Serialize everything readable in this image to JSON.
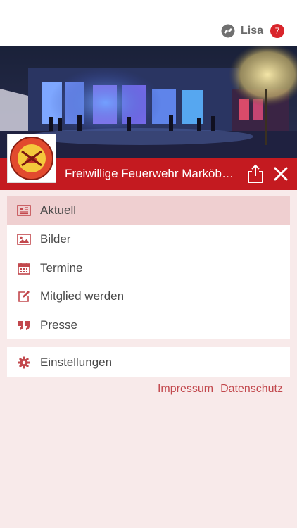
{
  "header": {
    "user_name": "Lisa",
    "notification_count": "7",
    "user_logo_icon": "lisa-logo-icon"
  },
  "banner": {
    "alt": "Feuerwehr building at night",
    "crest_text_top": "FEUERWEHR",
    "crest_text_bottom": "MARKÖBEL e.V."
  },
  "titlebar": {
    "title": "Freiwillige Feuerwehr Marköbel e.V.",
    "share_icon": "share-icon",
    "close_icon": "close-icon",
    "background_color": "#c41a20"
  },
  "menu": {
    "items": [
      {
        "label": "Aktuell",
        "icon": "newspaper-icon",
        "active": true
      },
      {
        "label": "Bilder",
        "icon": "image-icon",
        "active": false
      },
      {
        "label": "Termine",
        "icon": "calendar-icon",
        "active": false
      },
      {
        "label": "Mitglied werden",
        "icon": "edit-icon",
        "active": false
      },
      {
        "label": "Presse",
        "icon": "quote-icon",
        "active": false
      }
    ],
    "settings": {
      "label": "Einstellungen",
      "icon": "gear-icon"
    }
  },
  "footer_links": {
    "impressum": "Impressum",
    "datenschutz": "Datenschutz"
  },
  "colors": {
    "accent": "#c41a20",
    "icon": "#c2484d",
    "active_row": "#efcfd0",
    "page_background": "#f8eaea"
  }
}
